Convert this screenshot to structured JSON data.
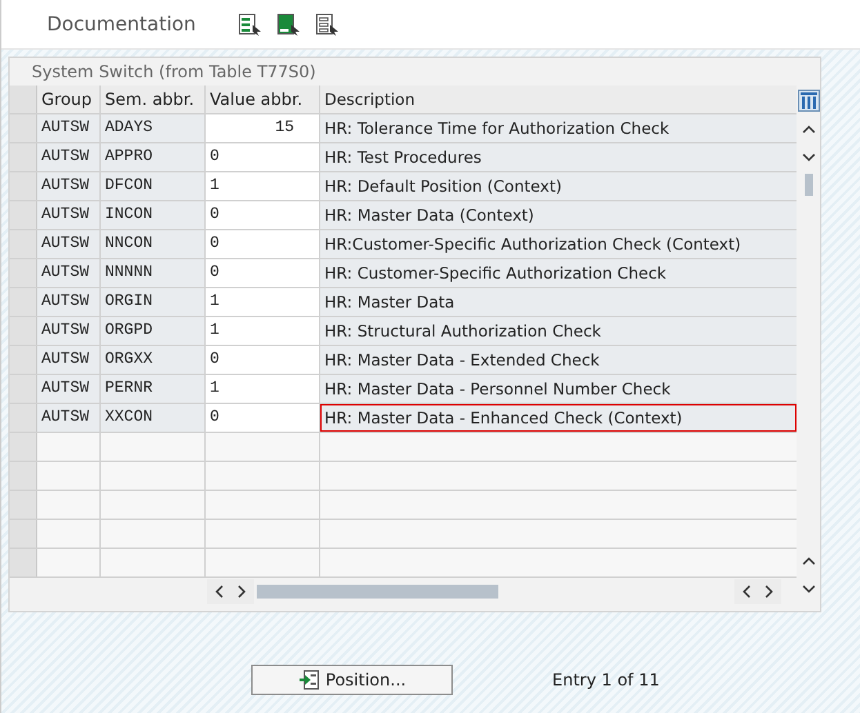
{
  "toolbar": {
    "label": "Documentation"
  },
  "table": {
    "title": "System Switch (from Table T77S0)",
    "columns": [
      "Group",
      "Sem. abbr.",
      "Value abbr.",
      "Description"
    ],
    "rows": [
      {
        "group": "AUTSW",
        "sem": "ADAYS",
        "value": "15",
        "right_aligned": true,
        "description": "HR: Tolerance Time for Authorization Check",
        "focused": false
      },
      {
        "group": "AUTSW",
        "sem": "APPRO",
        "value": "0",
        "right_aligned": false,
        "description": "HR: Test Procedures",
        "focused": false
      },
      {
        "group": "AUTSW",
        "sem": "DFCON",
        "value": "1",
        "right_aligned": false,
        "description": "HR: Default Position (Context)",
        "focused": false
      },
      {
        "group": "AUTSW",
        "sem": "INCON",
        "value": "0",
        "right_aligned": false,
        "description": "HR: Master Data (Context)",
        "focused": false
      },
      {
        "group": "AUTSW",
        "sem": "NNCON",
        "value": "0",
        "right_aligned": false,
        "description": "HR:Customer-Specific Authorization Check (Context)",
        "focused": false
      },
      {
        "group": "AUTSW",
        "sem": "NNNNN",
        "value": "0",
        "right_aligned": false,
        "description": "HR: Customer-Specific Authorization Check",
        "focused": false
      },
      {
        "group": "AUTSW",
        "sem": "ORGIN",
        "value": "1",
        "right_aligned": false,
        "description": "HR: Master Data",
        "focused": false
      },
      {
        "group": "AUTSW",
        "sem": "ORGPD",
        "value": "1",
        "right_aligned": false,
        "description": "HR: Structural Authorization Check",
        "focused": false
      },
      {
        "group": "AUTSW",
        "sem": "ORGXX",
        "value": "0",
        "right_aligned": false,
        "description": "HR: Master Data - Extended Check",
        "focused": false
      },
      {
        "group": "AUTSW",
        "sem": "PERNR",
        "value": "1",
        "right_aligned": false,
        "description": "HR: Master Data - Personnel Number Check",
        "focused": false
      },
      {
        "group": "AUTSW",
        "sem": "XXCON",
        "value": "0",
        "right_aligned": false,
        "description": "HR: Master Data - Enhanced Check (Context)",
        "focused": true
      }
    ]
  },
  "position_button": "Position...",
  "entry_status": "Entry 1 of 11"
}
